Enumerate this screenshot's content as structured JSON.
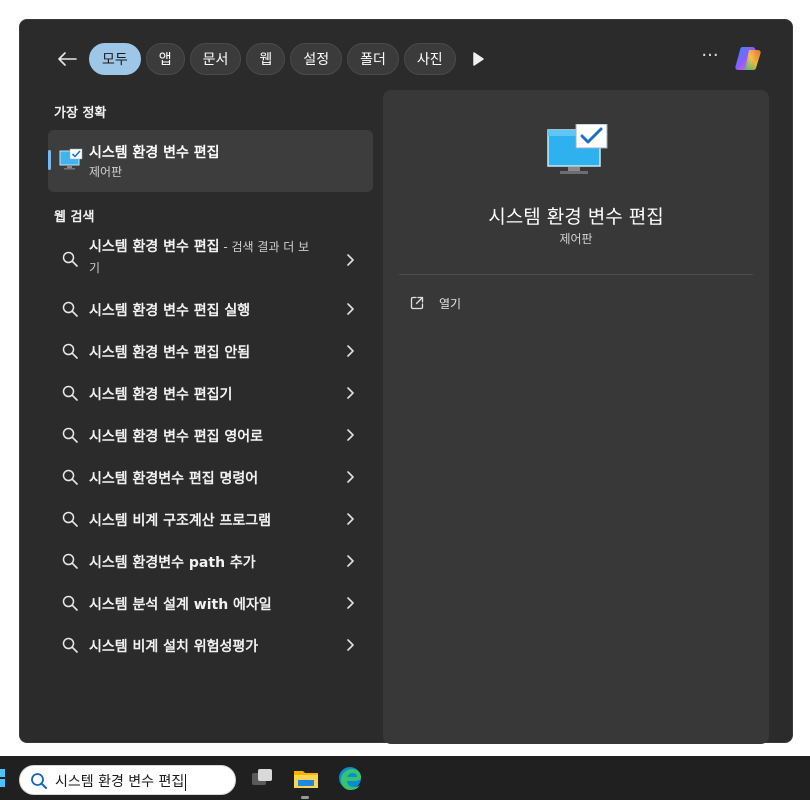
{
  "tabs": [
    {
      "label": "모두",
      "active": true
    },
    {
      "label": "앱",
      "active": false
    },
    {
      "label": "문서",
      "active": false
    },
    {
      "label": "웹",
      "active": false
    },
    {
      "label": "설정",
      "active": false
    },
    {
      "label": "폴더",
      "active": false
    },
    {
      "label": "사진",
      "active": false
    }
  ],
  "more_label": "···",
  "best_match": {
    "section_title": "가장 정확",
    "title": "시스템 환경 변수 편집",
    "subtitle": "제어판",
    "icon": "system-properties-icon"
  },
  "web_search": {
    "section_title": "웹 검색",
    "items": [
      {
        "text": "시스템 환경 변수 편집",
        "suffix": " - 검색 결과 더 보기"
      },
      {
        "text": "시스템 환경 변수 편집 실행"
      },
      {
        "text": "시스템 환경 변수 편집 안됨"
      },
      {
        "text": "시스템 환경 변수 편집기"
      },
      {
        "text": "시스템 환경 변수 편집 영어로"
      },
      {
        "text": "시스템 환경변수 편집 명령어"
      },
      {
        "text": "시스템 비계 구조계산 프로그램"
      },
      {
        "text": "시스템 환경변수 path 추가"
      },
      {
        "text": "시스템 분석 설계 with 에자일"
      },
      {
        "text": "시스템 비계 설치 위험성평가"
      }
    ]
  },
  "preview": {
    "title": "시스템 환경 변수 편집",
    "subtitle": "제어판",
    "action_open": "열기"
  },
  "taskbar": {
    "search_value": "시스템 환경 변수 편집"
  },
  "colors": {
    "accent": "#76b9ed",
    "active_tab": "#9ec6e6",
    "panel_bg": "#2b2b2b",
    "preview_bg": "#383838"
  }
}
